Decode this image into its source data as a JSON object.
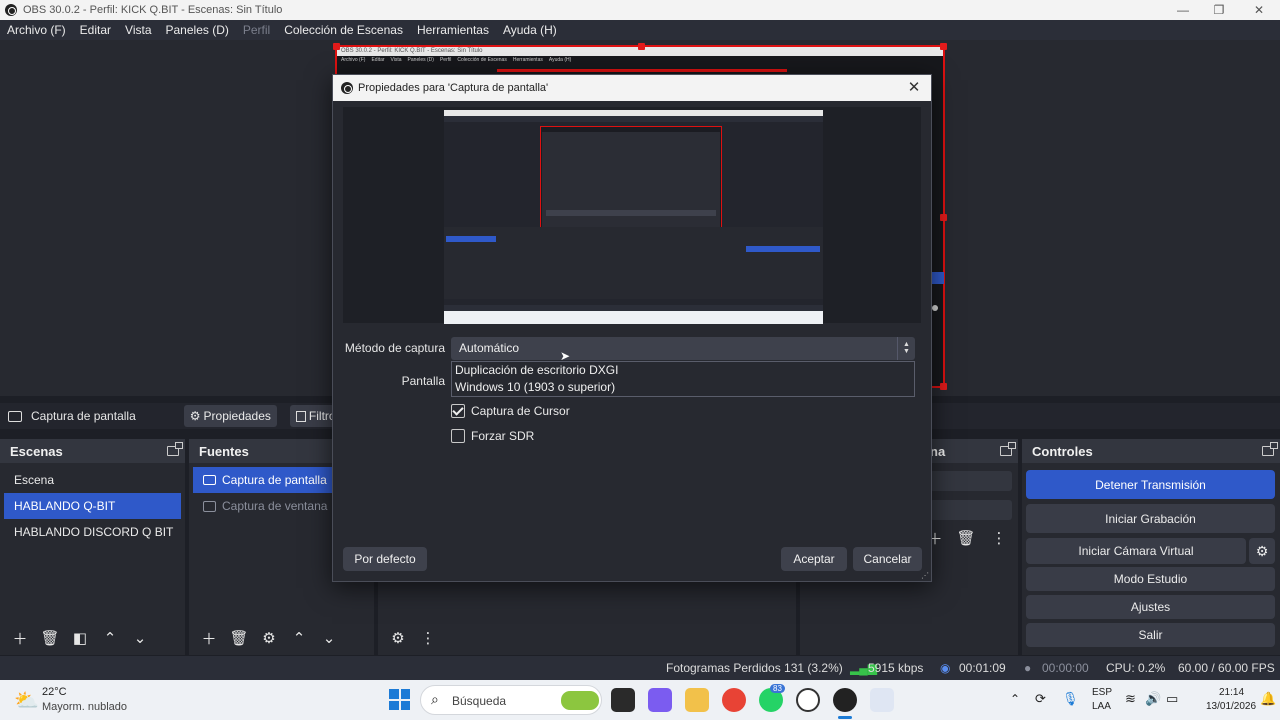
{
  "window": {
    "title": "OBS 30.0.2 - Perfil: KICK Q.BIT - Escenas: Sin Título",
    "min_icon": "minimize-icon",
    "max_icon": "maximize-icon",
    "close_icon": "close-icon"
  },
  "menu": {
    "items": [
      "Archivo (F)",
      "Editar",
      "Vista",
      "Paneles (D)",
      "Perfil",
      "Colección de Escenas",
      "Herramientas",
      "Ayuda (H)"
    ]
  },
  "preview_mini": {
    "title": "OBS 30.0.2 - Perfil: KICK Q.BIT - Escenas: Sin Título",
    "menu": [
      "Archivo (F)",
      "Editar",
      "Vista",
      "Paneles (D)",
      "Perfil",
      "Colección de Escenas",
      "Herramientas",
      "Ayuda (H)"
    ]
  },
  "source_toolbar": {
    "source_name": "Captura de pantalla",
    "properties_label": "Propiedades",
    "filters_label": "Filtro"
  },
  "scenes": {
    "header": "Escenas",
    "items": [
      "Escena",
      "HABLANDO Q-BIT",
      "HABLANDO DISCORD Q BIT"
    ],
    "selected": "HABLANDO Q-BIT"
  },
  "sources": {
    "header": "Fuentes",
    "items": [
      "Captura de pantalla",
      "Captura de ventana"
    ]
  },
  "audio": {
    "header_fragment": "na"
  },
  "controls": {
    "header": "Controles",
    "stop_stream": "Detener Transmisión",
    "start_record": "Iniciar Grabación",
    "virtual_cam": "Iniciar Cámara Virtual",
    "studio_mode": "Modo Estudio",
    "settings": "Ajustes",
    "exit": "Salir"
  },
  "status": {
    "dropped_frames": "Fotogramas Perdidos 131 (3.2%)",
    "bitrate": "5915 kbps",
    "stream_time": "00:01:09",
    "record_time": "00:00:00",
    "cpu": "CPU: 0.2%",
    "fps": "60.00 / 60.00 FPS"
  },
  "dialog": {
    "title": "Propiedades para 'Captura de pantalla'",
    "capture_method_label": "Método de captura",
    "capture_method_value": "Automático",
    "screen_label": "Pantalla",
    "dropdown_options": [
      "Duplicación de escritorio DXGI",
      "Windows 10 (1903 o superior)"
    ],
    "capture_cursor_label": "Captura de Cursor",
    "capture_cursor_checked": true,
    "force_sdr_label": "Forzar SDR",
    "force_sdr_checked": false,
    "defaults_button": "Por defecto",
    "accept_button": "Aceptar",
    "cancel_button": "Cancelar"
  },
  "taskbar": {
    "temperature": "22°C",
    "weather": "Mayorm. nublado",
    "search_placeholder": "Búsqueda",
    "whatsapp_badge": "83",
    "language": "ESP",
    "layout": "LAA",
    "time": "21:14",
    "date": "13/01/2026"
  },
  "colors": {
    "accent": "#2f59c9",
    "background": "#1d1f26",
    "panel": "#272930",
    "selection_border": "#e31b1b"
  }
}
